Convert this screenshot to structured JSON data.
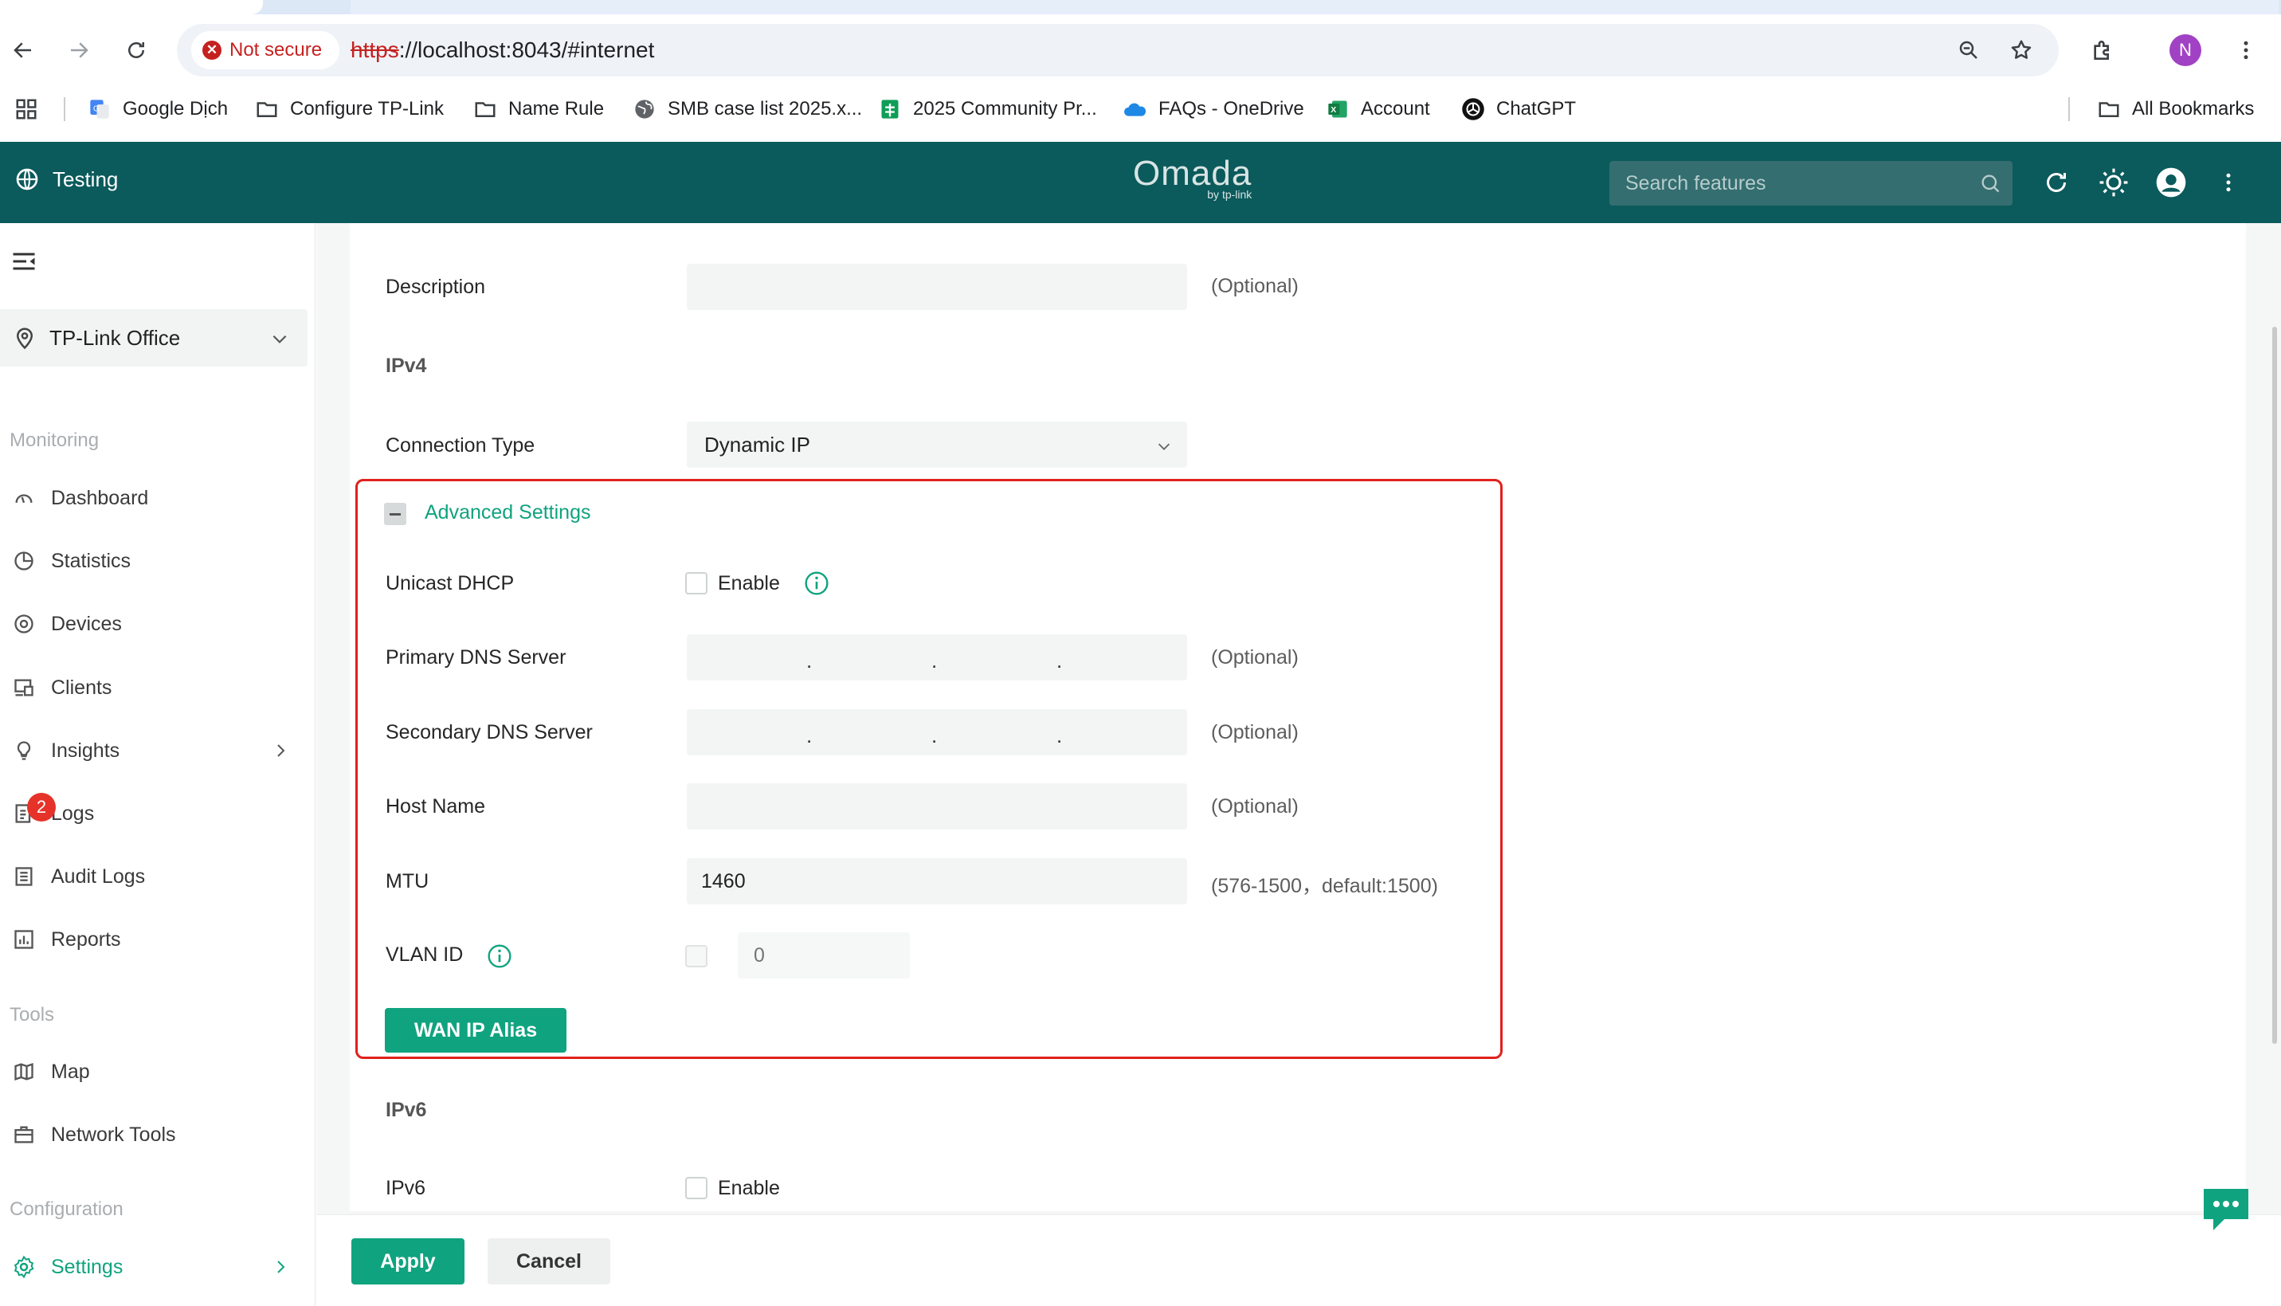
{
  "browser": {
    "security_label": "Not secure",
    "url_scheme": "https",
    "url_rest": "://localhost:8043/#internet",
    "profile_initial": "N",
    "bookmarks": [
      {
        "label": "Google Dịch",
        "icon": "google-translate-icon"
      },
      {
        "label": "Configure TP-Link",
        "icon": "folder-icon"
      },
      {
        "label": "Name Rule",
        "icon": "folder-icon"
      },
      {
        "label": "SMB case list 2025.x...",
        "icon": "globe-icon"
      },
      {
        "label": "2025 Community Pr...",
        "icon": "sheets-icon"
      },
      {
        "label": "FAQs - OneDrive",
        "icon": "onedrive-icon"
      },
      {
        "label": "Account",
        "icon": "excel-icon"
      },
      {
        "label": "ChatGPT",
        "icon": "chatgpt-icon"
      }
    ],
    "all_bookmarks": "All Bookmarks"
  },
  "header": {
    "site": "Testing",
    "logo_main": "Omada",
    "logo_sub": "by tp-link",
    "search_placeholder": "Search features"
  },
  "sidebar": {
    "site_selector": "TP-Link Office",
    "sections": {
      "monitoring": "Monitoring",
      "tools": "Tools",
      "configuration": "Configuration"
    },
    "items": {
      "dashboard": "Dashboard",
      "statistics": "Statistics",
      "devices": "Devices",
      "clients": "Clients",
      "insights": "Insights",
      "logs": "Logs",
      "logs_badge": "2",
      "audit_logs": "Audit Logs",
      "reports": "Reports",
      "map": "Map",
      "network_tools": "Network Tools",
      "settings": "Settings"
    }
  },
  "form": {
    "description_label": "Description",
    "description_value": "",
    "optional": "(Optional)",
    "ipv4_heading": "IPv4",
    "connection_type_label": "Connection Type",
    "connection_type_value": "Dynamic IP",
    "advanced_settings": "Advanced Settings",
    "unicast_dhcp_label": "Unicast DHCP",
    "enable": "Enable",
    "primary_dns_label": "Primary DNS Server",
    "secondary_dns_label": "Secondary DNS Server",
    "ip_dot": ".",
    "host_name_label": "Host Name",
    "host_name_value": "",
    "mtu_label": "MTU",
    "mtu_value": "1460",
    "mtu_hint": "(576-1500，default:1500)",
    "vlan_id_label": "VLAN ID",
    "vlan_id_placeholder": "0",
    "wan_ip_alias": "WAN IP Alias",
    "ipv6_heading": "IPv6",
    "ipv6_label": "IPv6"
  },
  "footer": {
    "apply": "Apply",
    "cancel": "Cancel"
  },
  "colors": {
    "header_bg": "#0b5a5c",
    "accent": "#10a37f",
    "highlight_border": "#e0211d",
    "badge": "#e5332a"
  }
}
